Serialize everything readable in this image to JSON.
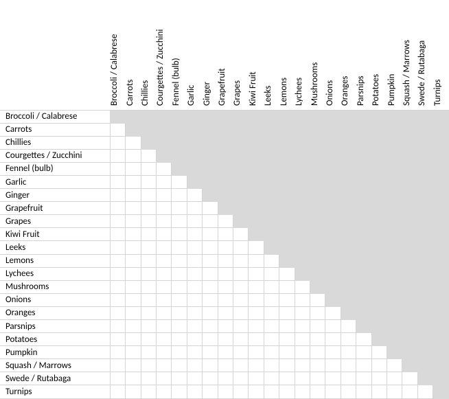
{
  "matrix": {
    "items": [
      "Broccoli / Calabrese",
      "Carrots",
      "Chillies",
      "Courgettes / Zucchini",
      "Fennel (bulb)",
      "Garlic",
      "Ginger",
      "Grapefruit",
      "Grapes",
      "Kiwi Fruit",
      "Leeks",
      "Lemons",
      "Lychees",
      "Mushrooms",
      "Onions",
      "Oranges",
      "Parsnips",
      "Potatoes",
      "Pumpkin",
      "Squash / Marrows",
      "Swede / Rutabaga",
      "Turnips"
    ]
  }
}
